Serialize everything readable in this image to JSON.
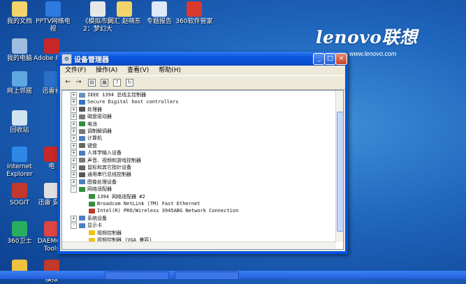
{
  "brand": {
    "logo": "lenovo联想",
    "url": "www.lenovo.com"
  },
  "desktop_icons": [
    {
      "id": "my-docs",
      "label": "我的文档",
      "color": "#f3d36a"
    },
    {
      "id": "pptv",
      "label": "PPTV网络电视",
      "color": "#2d7be0"
    },
    {
      "id": "moni",
      "label": "《模拟市民2：梦幻大",
      "color": "#e7e7e7"
    },
    {
      "id": "cihui",
      "label": "词汇 赵晓东",
      "color": "#f3d36a"
    },
    {
      "id": "report",
      "label": "专题报告",
      "color": "#dfe8f6"
    },
    {
      "id": "360mgr",
      "label": "360软件管家",
      "color": "#d93a2d"
    },
    {
      "id": "my-pc",
      "label": "我的电脑",
      "color": "#9fbde0"
    },
    {
      "id": "adobe",
      "label": "Adobe Re X",
      "color": "#c62828"
    },
    {
      "id": "neighbors",
      "label": "网上邻居",
      "color": "#5fa7e0"
    },
    {
      "id": "xunlei",
      "label": "迅雷看",
      "color": "#2a70c8"
    },
    {
      "id": "recycle",
      "label": "回收站",
      "color": "#cfe3f2"
    },
    {
      "id": "ie",
      "label": "Internet Explorer",
      "color": "#2d88e6"
    },
    {
      "id": "ie-side",
      "label": "电",
      "color": "#c62828"
    },
    {
      "id": "scorm",
      "label": "SOGIT",
      "color": "#c0392b"
    },
    {
      "id": "xunlei2",
      "label": "迅雷 安全",
      "color": "#e0e0e0"
    },
    {
      "id": "360guard",
      "label": "360卫士",
      "color": "#27ae60"
    },
    {
      "id": "daemon",
      "label": "DAEMON Tools",
      "color": "#dd4444"
    },
    {
      "id": "bottom1",
      "label": "",
      "color": "#f0c040"
    },
    {
      "id": "bottom2",
      "label": "模拟",
      "color": "#c0392b"
    }
  ],
  "window": {
    "title": "设备管理器",
    "controls": {
      "minimize": "_",
      "maximize": "□",
      "close": "×"
    },
    "menu": [
      "文件(F)",
      "操作(A)",
      "查看(V)",
      "帮助(H)"
    ],
    "toolbar": [
      "back-icon",
      "forward-icon",
      "properties-icon",
      "tree-view-icon",
      "help-icon",
      "refresh-icon"
    ]
  },
  "tree": [
    {
      "label": "IEEE 1394 总线主控制器",
      "expander": "+",
      "icon_color": "#6b8fb5"
    },
    {
      "label": "Secure Digital host controllers",
      "expander": "+",
      "icon_color": "#3a73c0"
    },
    {
      "label": "处理器",
      "expander": "+",
      "icon_color": "#555555"
    },
    {
      "label": "磁盘驱动器",
      "expander": "+",
      "icon_color": "#777777"
    },
    {
      "label": "电池",
      "expander": "+",
      "icon_color": "#2f8f3a"
    },
    {
      "label": "调制解调器",
      "expander": "+",
      "icon_color": "#777777"
    },
    {
      "label": "计算机",
      "expander": "+",
      "icon_color": "#4a7ec0"
    },
    {
      "label": "键盘",
      "expander": "+",
      "icon_color": "#666666"
    },
    {
      "label": "人体学输入设备",
      "expander": "+",
      "icon_color": "#4a7ec0"
    },
    {
      "label": "声音、视频和游戏控制器",
      "expander": "+",
      "icon_color": "#7a7a7a"
    },
    {
      "label": "鼠标和其它指针设备",
      "expander": "+",
      "icon_color": "#666666"
    },
    {
      "label": "通用串行总线控制器",
      "expander": "+",
      "icon_color": "#555555"
    },
    {
      "label": "图像处理设备",
      "expander": "+",
      "icon_color": "#4a7ec0"
    },
    {
      "label": "网络适配器",
      "expander": "-",
      "icon_color": "#2f8f3a"
    },
    {
      "label": "1394 网络适配器 #2",
      "expander": "",
      "icon_color": "#2f8f3a",
      "child": true
    },
    {
      "label": "Broadcom NetLink (TM) Fast Ethernet",
      "expander": "",
      "icon_color": "#2f8f3a",
      "child": true
    },
    {
      "label": "Intel(R) PRO/Wireless 3945ABG Network Connection",
      "expander": "",
      "icon_color": "#c0392b",
      "child": true
    },
    {
      "label": "系统设备",
      "expander": "+",
      "icon_color": "#4a7ec0"
    },
    {
      "label": "显示卡",
      "expander": "-",
      "icon_color": "#4a7ec0"
    },
    {
      "label": "视频控制器",
      "expander": "",
      "icon_color": "#f1c40f",
      "child": true
    },
    {
      "label": "视频控制器 (VGA 兼容)",
      "expander": "",
      "icon_color": "#f1c40f",
      "child": true
    }
  ]
}
